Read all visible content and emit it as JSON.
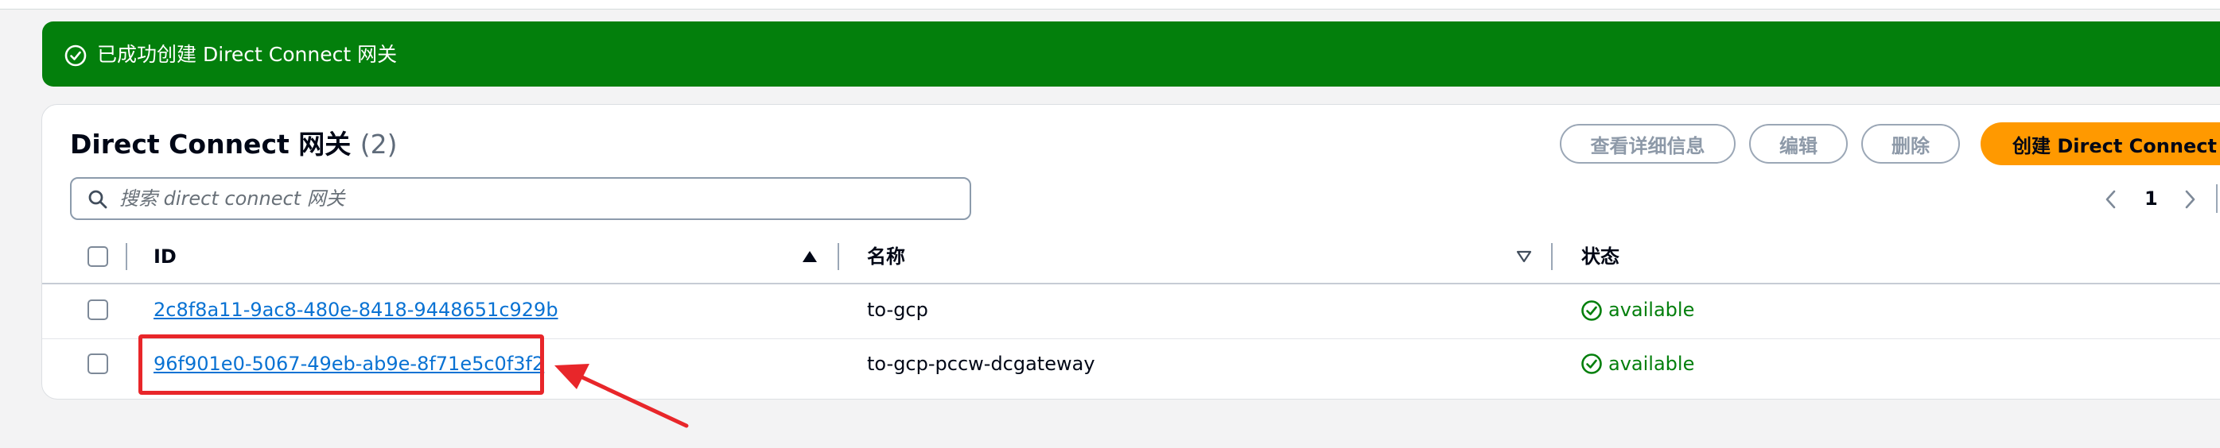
{
  "flash": {
    "message": "已成功创建 Direct Connect 网关",
    "icon": "check-circle-icon",
    "color": "#037f0c"
  },
  "header": {
    "title": "Direct Connect 网关",
    "count": "(2)"
  },
  "actions": {
    "view_details": "查看详细信息",
    "edit": "编辑",
    "delete": "删除",
    "create": "创建 Direct Connect 网"
  },
  "search": {
    "placeholder": "搜索 direct connect 网关",
    "value": ""
  },
  "pagination": {
    "current_page": "1"
  },
  "table": {
    "columns": [
      "ID",
      "名称",
      "状态"
    ],
    "rows": [
      {
        "id": "2c8f8a11-9ac8-480e-8418-9448651c929b",
        "name": "to-gcp",
        "status": "available"
      },
      {
        "id": "96f901e0-5067-49eb-ab9e-8f71e5c0f3f2",
        "name": "to-gcp-pccw-dcgateway",
        "status": "available"
      }
    ]
  },
  "colors": {
    "accent": "#ff9900",
    "link": "#0972d3",
    "success": "#037f0c",
    "annotation": "#e8262a"
  }
}
